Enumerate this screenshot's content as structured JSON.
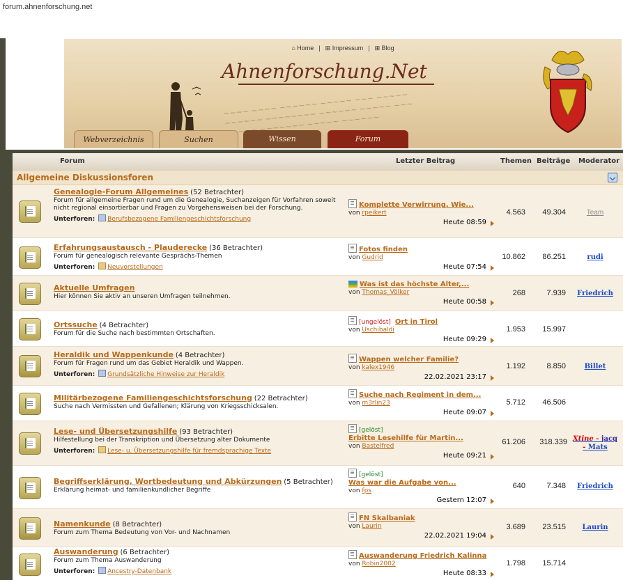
{
  "browser": {
    "url": "forum.ahnenforschung.net"
  },
  "site": {
    "topnav": [
      {
        "icon": "home-icon",
        "label": "Home"
      },
      {
        "icon": "impressum-icon",
        "label": "Impressum"
      },
      {
        "icon": "blog-icon",
        "label": "Blog"
      }
    ],
    "logo": "Ahnenforschung.Net",
    "tabs": [
      "Webverzeichnis",
      "Suchen",
      "Wissen",
      "Forum"
    ]
  },
  "table": {
    "headers": {
      "forum": "Forum",
      "last": "Letzter Beitrag",
      "themen": "Themen",
      "beitraege": "Beiträge",
      "moderator": "Moderator"
    },
    "category": "Allgemeine Diskussionsforen"
  },
  "sub_label": "Unterforen:",
  "by_label": "von",
  "forums": [
    {
      "name": "Genealogie-Forum Allgemeines",
      "viewers": "(52 Betrachter)",
      "desc": "Forum für allgemeine Fragen rund um die Genealogie, Suchanzeigen für Vorfahren soweit nicht regional einsortierbar und Fragen zu Vorgehensweisen bei der Forschung.",
      "subforum": "Berufsbezogene Familiengeschichtsforschung",
      "last_prefix": "",
      "last_title": "Komplette Verwirrung. Wie...",
      "last_author": "rpeikert",
      "last_time": "Heute 08:59",
      "themen": "4.563",
      "beitraege": "49.304",
      "moderator": "Team"
    },
    {
      "name": "Erfahrungsaustausch - Plauderecke",
      "viewers": "(36 Betrachter)",
      "desc": "Forum für genealogisch relevante Gesprächs-Themen",
      "subforum": "Neuvorstellungen",
      "last_prefix": "",
      "last_title": "Fotos finden",
      "last_author": "Gudrid",
      "last_time": "Heute 07:54",
      "themen": "10.862",
      "beitraege": "86.251",
      "moderator": "rudi"
    },
    {
      "name": "Aktuelle Umfragen",
      "viewers": "",
      "desc": "Hier können Sie aktiv an unseren Umfragen teilnehmen.",
      "subforum": "",
      "last_prefix": "",
      "last_title": "Was ist das höchste Alter,...",
      "last_author": "Thomas_Völker",
      "last_time": "Heute 00:58",
      "themen": "268",
      "beitraege": "7.939",
      "moderator": "Friedrich"
    },
    {
      "name": "Ortssuche",
      "viewers": "(4 Betrachter)",
      "desc": "Forum für die Suche nach bestimmten Ortschaften.",
      "subforum": "",
      "last_prefix": "[ungelöst]",
      "last_title": "Ort in Tirol",
      "last_author": "Uschibaldi",
      "last_time": "Heute 09:29",
      "themen": "1.953",
      "beitraege": "15.997",
      "moderator": ""
    },
    {
      "name": "Heraldik und Wappenkunde",
      "viewers": "(4 Betrachter)",
      "desc": "Forum für Fragen rund um das Gebiet Heraldik und Wappen.",
      "subforum": "Grundsätzliche Hinweise zur Heraldik",
      "last_prefix": "",
      "last_title": "Wappen welcher Familie?",
      "last_author": "kalex1946",
      "last_time": "22.02.2021 23:17",
      "themen": "1.192",
      "beitraege": "8.850",
      "moderator": "Billet"
    },
    {
      "name": "Militärbezogene Familiengeschichtsforschung",
      "viewers": "(22 Betrachter)",
      "desc": "Suche nach Vermissten und Gefallenen; Klärung von Kriegsschicksalen.",
      "subforum": "",
      "last_prefix": "",
      "last_title": "Suche nach Regiment in dem...",
      "last_author": "m3rlin23",
      "last_time": "Heute 09:07",
      "themen": "5.712",
      "beitraege": "46.506",
      "moderator": ""
    },
    {
      "name": "Lese- und Übersetzungshilfe",
      "viewers": "(93 Betrachter)",
      "desc": "Hilfestellung bei der Transkription und Übersetzung alter Dokumente",
      "subforum": "Lese- u. Übersetzungshilfe für fremdsprachige Texte",
      "last_prefix": "[gelöst]",
      "last_title": "Erbitte Lesehilfe für Martin...",
      "last_author": "Bastelfred",
      "last_time": "Heute 09:21",
      "themen": "61.206",
      "beitraege": "318.339",
      "moderator": ""
    },
    {
      "name": "Begriffserklärung, Wortbedeutung und Abkürzungen",
      "viewers": "(5 Betrachter)",
      "desc": "Erklärung heimat- und familienkundlicher Begriffe",
      "subforum": "",
      "last_prefix": "[gelöst]",
      "last_title": "Was war die Aufgabe von...",
      "last_author": "fps",
      "last_time": "Gestern 12:07",
      "themen": "640",
      "beitraege": "7.348",
      "moderator": "Friedrich"
    },
    {
      "name": "Namenkunde",
      "viewers": "(8 Betrachter)",
      "desc": "Forum zum Thema Bedeutung von Vor- und Nachnamen",
      "subforum": "",
      "last_prefix": "",
      "last_title": "FN Skalbaniak",
      "last_author": "Laurin",
      "last_time": "22.02.2021 19:04",
      "themen": "3.689",
      "beitraege": "23.515",
      "moderator": "Laurin"
    },
    {
      "name": "Auswanderung",
      "viewers": "(6 Betrachter)",
      "desc": "Forum zum Thema Auswanderung",
      "subforum": "Ancestry-Datenbank",
      "last_prefix": "",
      "last_title": "Auswanderung Friedrich Kalinna",
      "last_author": "Robin2002",
      "last_time": "Heute 08:33",
      "themen": "1.798",
      "beitraege": "15.714",
      "moderator": ""
    }
  ],
  "multi_moderators": [
    "Xtine",
    "jacq",
    "Mats"
  ],
  "colors": {
    "link": "#b86a1a",
    "moderator": "#1a4ac8",
    "header_bg": "#e5cfa6"
  }
}
